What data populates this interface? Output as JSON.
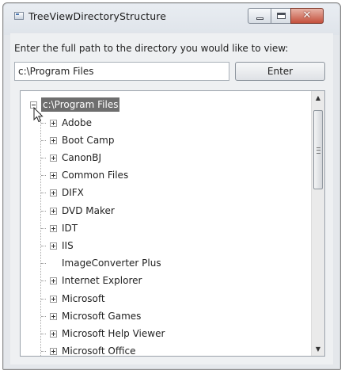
{
  "window": {
    "title": "TreeViewDirectoryStructure",
    "controls": {
      "close_glyph": "✕"
    }
  },
  "form": {
    "prompt": "Enter the full path to the directory you would like to view:",
    "path_value": "c:\\Program Files",
    "enter_label": "Enter"
  },
  "tree": {
    "root": {
      "label": "c:\\Program Files",
      "expanded": true,
      "selected": true
    },
    "children": [
      {
        "label": "Adobe",
        "has_children": true
      },
      {
        "label": "Boot Camp",
        "has_children": true
      },
      {
        "label": "CanonBJ",
        "has_children": true
      },
      {
        "label": "Common Files",
        "has_children": true
      },
      {
        "label": "DIFX",
        "has_children": true
      },
      {
        "label": "DVD Maker",
        "has_children": true
      },
      {
        "label": "IDT",
        "has_children": true
      },
      {
        "label": "IIS",
        "has_children": true
      },
      {
        "label": "ImageConverter Plus",
        "has_children": false
      },
      {
        "label": "Internet Explorer",
        "has_children": true
      },
      {
        "label": "Microsoft",
        "has_children": true
      },
      {
        "label": "Microsoft Games",
        "has_children": true
      },
      {
        "label": "Microsoft Help Viewer",
        "has_children": true
      },
      {
        "label": "Microsoft Office",
        "has_children": true
      }
    ]
  },
  "scrollbar": {
    "up_glyph": "▲",
    "down_glyph": "▼"
  },
  "colors": {
    "selection": "#6e6e6e",
    "close_button": "#c4503c"
  }
}
